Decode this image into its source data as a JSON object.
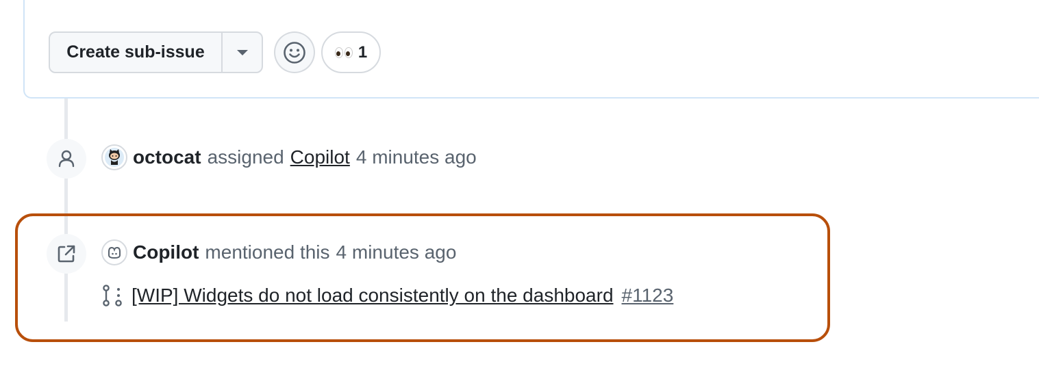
{
  "comment": {
    "create_sub_issue_label": "Create sub-issue",
    "reaction": {
      "emoji": "eyes-emoji",
      "count": "1"
    }
  },
  "timeline": {
    "assigned_event": {
      "icon": "person-icon",
      "actor": "octocat",
      "verb": "assigned",
      "target": "Copilot",
      "time": "4 minutes ago"
    },
    "mentioned_event": {
      "icon": "link-external-icon",
      "actor": "Copilot",
      "verb": "mentioned this",
      "time": "4 minutes ago",
      "pr": {
        "icon": "git-pull-request-draft-icon",
        "title": "[WIP] Widgets do not load consistently on the dashboard",
        "number": "#1123"
      }
    }
  },
  "colors": {
    "highlight_frame": "#b84f0b",
    "card_border": "#d0e4f7",
    "muted_text": "#59636e",
    "primary_text": "#1f2328"
  }
}
